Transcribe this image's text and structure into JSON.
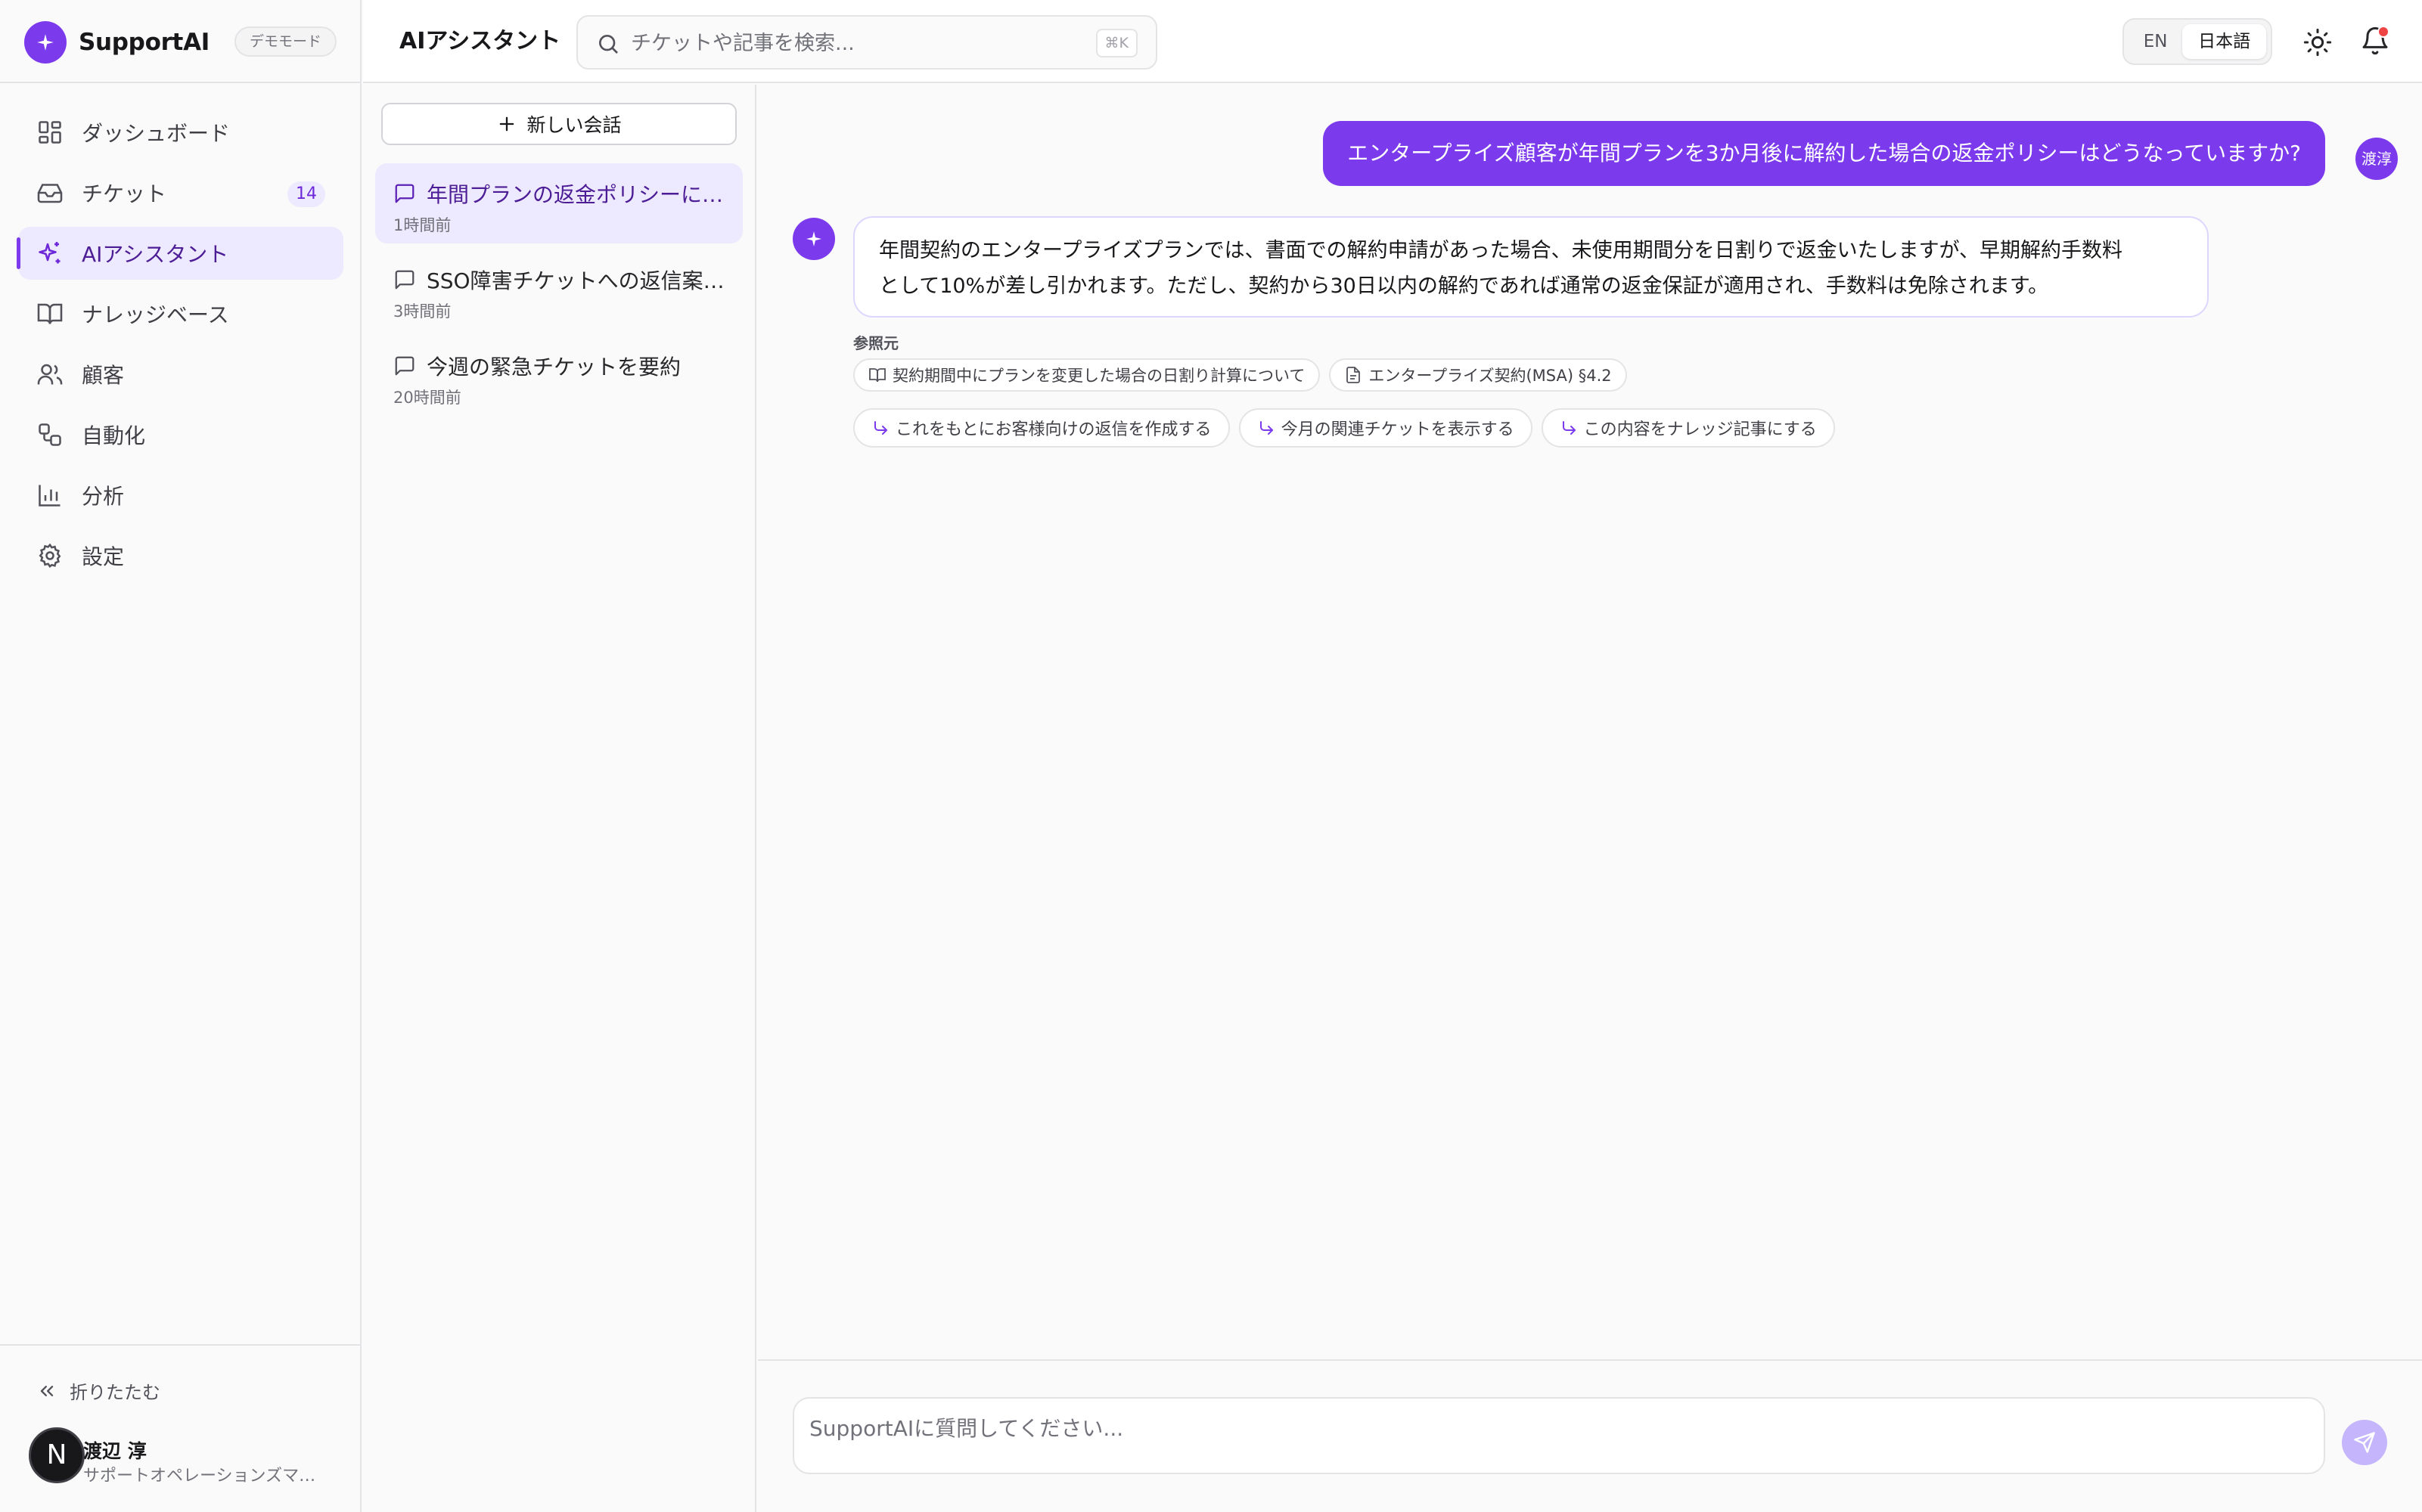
{
  "brand": {
    "name": "SupportAI",
    "mode_badge": "デモモード"
  },
  "nav": {
    "items": [
      {
        "label": "ダッシュボード",
        "icon": "dashboard-icon"
      },
      {
        "label": "チケット",
        "icon": "inbox-icon",
        "count": "14"
      },
      {
        "label": "AIアシスタント",
        "icon": "sparkles-icon",
        "active": true
      },
      {
        "label": "ナレッジベース",
        "icon": "book-icon"
      },
      {
        "label": "顧客",
        "icon": "users-icon"
      },
      {
        "label": "自動化",
        "icon": "workflow-icon"
      },
      {
        "label": "分析",
        "icon": "chart-icon"
      },
      {
        "label": "設定",
        "icon": "gear-icon"
      }
    ]
  },
  "sidebar_footer": {
    "collapse_label": "折りたたむ",
    "user": {
      "initial": "N",
      "name": "渡辺 淳",
      "role": "サポートオペレーションズマネージャー"
    }
  },
  "header": {
    "title": "AIアシスタント",
    "search_placeholder": "チケットや記事を検索...",
    "search_shortcut": "⌘K",
    "lang_en": "EN",
    "lang_ja": "日本語"
  },
  "conversations": {
    "new_label": "新しい会話",
    "items": [
      {
        "title": "年間プランの返金ポリシーについて",
        "time": "1時間前",
        "active": true
      },
      {
        "title": "SSO障害チケットへの返信案を作成",
        "time": "3時間前"
      },
      {
        "title": "今週の緊急チケットを要約",
        "time": "20時間前"
      }
    ]
  },
  "chat": {
    "user_message": "エンタープライズ顧客が年間プランを3か月後に解約した場合の返金ポリシーはどうなっていますか?",
    "user_avatar": "渡淳",
    "ai_message_line1": "年間契約のエンタープライズプランでは、書面での解約申請があった場合、未使用期間分を日割りで返金いたしますが、早期解約手数料",
    "ai_message_line2": "として10%が差し引かれます。ただし、契約から30日以内の解約であれば通常の返金保証が適用され、手数料は免除されます。",
    "sources_label": "参照元",
    "sources": [
      {
        "label": "契約期間中にプランを変更した場合の日割り計算について",
        "icon": "book-icon"
      },
      {
        "label": "エンタープライズ契約(MSA) §4.2",
        "icon": "document-icon"
      }
    ],
    "suggestions": [
      "これをもとにお客様向けの返信を作成する",
      "今月の関連チケットを表示する",
      "この内容をナレッジ記事にする"
    ],
    "composer_placeholder": "SupportAIに質問してください..."
  },
  "colors": {
    "accent": "#7c3aed",
    "accent_light": "#ede9fe",
    "notification": "#ef4444"
  }
}
